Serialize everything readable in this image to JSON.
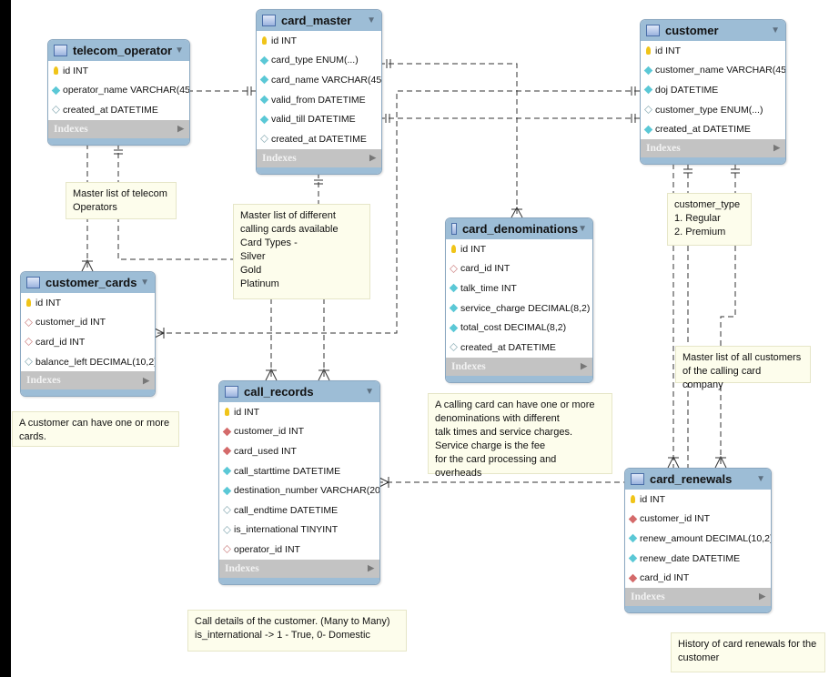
{
  "colors": {
    "header": "#9dbdd6",
    "indexes": "#c3c3c3",
    "note": "#fdfdec",
    "not_null": "#5bc8d6",
    "foreign_key": "#d46a6a",
    "primary_key": "#f0c419"
  },
  "indexes_label": "Indexes",
  "tables": [
    {
      "name": "telecom_operator",
      "columns": [
        {
          "t": "key",
          "label": "id INT"
        },
        {
          "t": "nn",
          "label": "operator_name VARCHAR(45)"
        },
        {
          "t": "col",
          "label": "created_at DATETIME"
        }
      ]
    },
    {
      "name": "card_master",
      "columns": [
        {
          "t": "key",
          "label": "id INT"
        },
        {
          "t": "nn",
          "label": "card_type ENUM(...)"
        },
        {
          "t": "nn",
          "label": "card_name VARCHAR(45)"
        },
        {
          "t": "nn",
          "label": "valid_from DATETIME"
        },
        {
          "t": "nn",
          "label": "valid_till DATETIME"
        },
        {
          "t": "col",
          "label": "created_at DATETIME"
        }
      ]
    },
    {
      "name": "customer",
      "columns": [
        {
          "t": "key",
          "label": "id INT"
        },
        {
          "t": "nn",
          "label": "customer_name VARCHAR(45)"
        },
        {
          "t": "nn",
          "label": "doj DATETIME"
        },
        {
          "t": "col",
          "label": "customer_type ENUM(...)"
        },
        {
          "t": "nn",
          "label": "created_at DATETIME"
        }
      ]
    },
    {
      "name": "card_denominations",
      "columns": [
        {
          "t": "key",
          "label": "id INT"
        },
        {
          "t": "fko",
          "label": "card_id INT"
        },
        {
          "t": "nn",
          "label": "talk_time INT"
        },
        {
          "t": "nn",
          "label": "service_charge DECIMAL(8,2)"
        },
        {
          "t": "nn",
          "label": "total_cost DECIMAL(8,2)"
        },
        {
          "t": "col",
          "label": "created_at DATETIME"
        }
      ]
    },
    {
      "name": "customer_cards",
      "columns": [
        {
          "t": "key",
          "label": "id INT"
        },
        {
          "t": "fko",
          "label": "customer_id INT"
        },
        {
          "t": "fko",
          "label": "card_id INT"
        },
        {
          "t": "col",
          "label": "balance_left DECIMAL(10,2)"
        }
      ]
    },
    {
      "name": "call_records",
      "columns": [
        {
          "t": "key",
          "label": "id INT"
        },
        {
          "t": "fk",
          "label": "customer_id INT"
        },
        {
          "t": "fk",
          "label": "card_used INT"
        },
        {
          "t": "nn",
          "label": "call_starttime DATETIME"
        },
        {
          "t": "nn",
          "label": "destination_number VARCHAR(20)"
        },
        {
          "t": "col",
          "label": "call_endtime DATETIME"
        },
        {
          "t": "col",
          "label": "is_international TINYINT"
        },
        {
          "t": "fko",
          "label": "operator_id INT"
        }
      ]
    },
    {
      "name": "card_renewals",
      "columns": [
        {
          "t": "key",
          "label": "id INT"
        },
        {
          "t": "fk",
          "label": "customer_id INT"
        },
        {
          "t": "nn",
          "label": "renew_amount DECIMAL(10,2)"
        },
        {
          "t": "nn",
          "label": "renew_date DATETIME"
        },
        {
          "t": "fk",
          "label": "card_id INT"
        }
      ]
    }
  ],
  "notes": [
    "Master list of telecom\nOperators",
    "Master list of different\ncalling cards available\nCard Types -\nSilver\nGold\nPlatinum",
    "A calling card can have one or more\ndenominations with different\ntalk times and service charges.\nService charge is the fee\nfor the card processing and overheads",
    "customer_type\n1. Regular\n2. Premium",
    "Master list of all customers\nof the calling card company",
    "A customer can have one or more\ncards.",
    "Call details of the customer. (Many to Many)\nis_international  -> 1 - True, 0- Domestic",
    "History of card renewals for the\ncustomer"
  ]
}
